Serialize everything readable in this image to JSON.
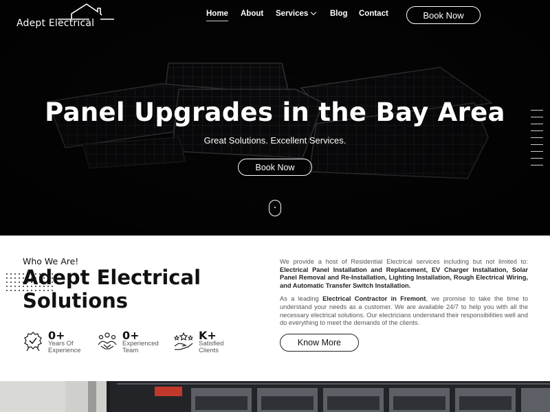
{
  "brand": {
    "name": "Adept Electrical"
  },
  "nav": {
    "items": [
      {
        "label": "Home",
        "active": true
      },
      {
        "label": "About",
        "active": false
      },
      {
        "label": "Services",
        "active": false,
        "has_dropdown": true
      },
      {
        "label": "Blog",
        "active": false
      },
      {
        "label": "Contact",
        "active": false
      }
    ],
    "cta": "Book Now"
  },
  "hero": {
    "title": "Panel Upgrades in the Bay Area",
    "subtitle": "Great Solutions. Excellent Services.",
    "cta": "Book Now",
    "slider_count": 9
  },
  "about": {
    "eyebrow": "Who We Are!",
    "title": "Adept Electrical Solutions",
    "stats": [
      {
        "value": "0+",
        "label": "Years Of Experience",
        "icon": "award-badge-icon"
      },
      {
        "value": "0+",
        "label": "Experienced Team",
        "icon": "team-handshake-icon"
      },
      {
        "value": "K+",
        "label": "Satisfied Clients",
        "icon": "hand-stars-icon"
      }
    ],
    "desc1_intro": "We provide a host of Residential Electrical services including but not limited to:",
    "desc1_services": "Electrical Panel Installation and Replacement, EV Charger Installation, Solar Panel Removal and Re-Installation, Lighting Installation, Rough Electrical Wiring, and Automatic Transfer Switch Installation.",
    "desc2_pre": "As a leading",
    "desc2_bold": "Electrical Contractor in Fremont",
    "desc2_post": ", we promise to take the time to understand your needs as a customer. We are available 24/7 to help you with all the necessary electrical solutions. Our electricians understand their responsibilities well and do everything to meet the demands of the clients.",
    "cta": "Know More"
  },
  "colors": {
    "hero_bg": "#050505",
    "accent": "#ffffff",
    "text": "#111111",
    "muted": "#555555"
  }
}
